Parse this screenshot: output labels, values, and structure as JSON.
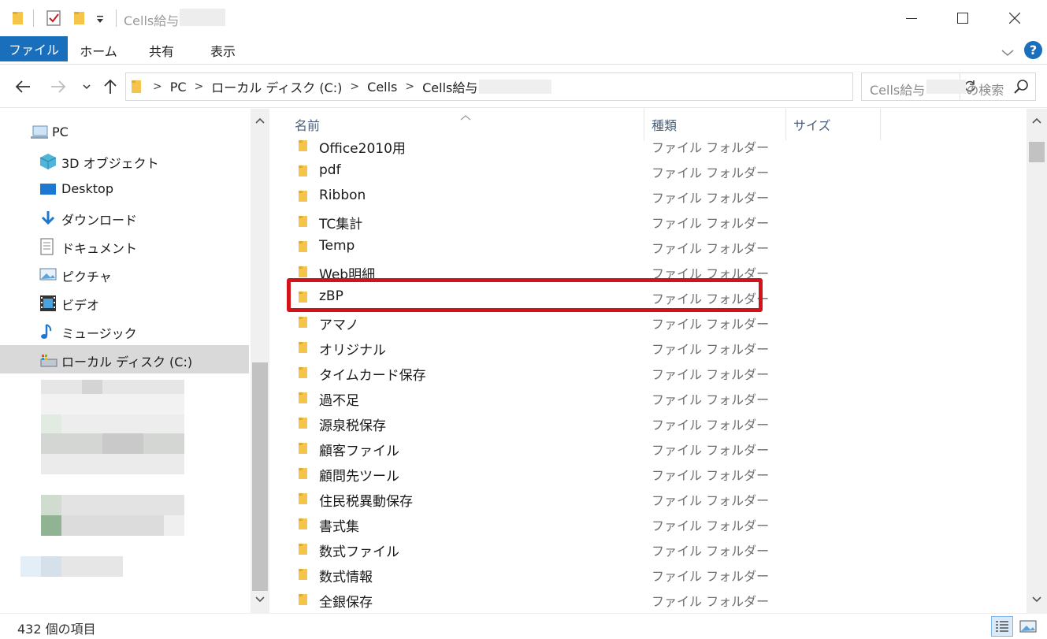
{
  "window": {
    "title": "Cells給与",
    "controls": {
      "minimize": "─",
      "maximize": "☐",
      "close": "✕"
    }
  },
  "ribbon": {
    "tabs": [
      {
        "label": "ファイル",
        "active": true
      },
      {
        "label": "ホーム"
      },
      {
        "label": "共有"
      },
      {
        "label": "表示"
      }
    ],
    "help_label": "?"
  },
  "address": {
    "crumbs": [
      "PC",
      "ローカル ディスク (C:)",
      "Cells",
      "Cells給与"
    ],
    "search_placeholder_prefix": "Cells給与",
    "search_placeholder_suffix": "の検索"
  },
  "nav": {
    "items": [
      {
        "label": "PC",
        "icon": "pc-icon"
      },
      {
        "label": "3D オブジェクト",
        "icon": "3d-objects-icon"
      },
      {
        "label": "Desktop",
        "icon": "desktop-icon"
      },
      {
        "label": "ダウンロード",
        "icon": "download-icon"
      },
      {
        "label": "ドキュメント",
        "icon": "document-icon"
      },
      {
        "label": "ピクチャ",
        "icon": "pictures-icon"
      },
      {
        "label": "ビデオ",
        "icon": "video-icon"
      },
      {
        "label": "ミュージック",
        "icon": "music-icon"
      },
      {
        "label": "ローカル ディスク (C:)",
        "icon": "local-disk-icon",
        "selected": true
      }
    ]
  },
  "columns": {
    "name": "名前",
    "type": "種類",
    "size": "サイズ"
  },
  "files": [
    {
      "name": "Office2010用",
      "type": "ファイル フォルダー"
    },
    {
      "name": "pdf",
      "type": "ファイル フォルダー"
    },
    {
      "name": "Ribbon",
      "type": "ファイル フォルダー"
    },
    {
      "name": "TC集計",
      "type": "ファイル フォルダー"
    },
    {
      "name": "Temp",
      "type": "ファイル フォルダー"
    },
    {
      "name": "Web明細",
      "type": "ファイル フォルダー"
    },
    {
      "name": "zBP",
      "type": "ファイル フォルダー",
      "highlighted": true
    },
    {
      "name": "アマノ",
      "type": "ファイル フォルダー"
    },
    {
      "name": "オリジナル",
      "type": "ファイル フォルダー"
    },
    {
      "name": "タイムカード保存",
      "type": "ファイル フォルダー"
    },
    {
      "name": "過不足",
      "type": "ファイル フォルダー"
    },
    {
      "name": "源泉税保存",
      "type": "ファイル フォルダー"
    },
    {
      "name": "顧客ファイル",
      "type": "ファイル フォルダー"
    },
    {
      "name": "顧問先ツール",
      "type": "ファイル フォルダー"
    },
    {
      "name": "住民税異動保存",
      "type": "ファイル フォルダー"
    },
    {
      "name": "書式集",
      "type": "ファイル フォルダー"
    },
    {
      "name": "数式ファイル",
      "type": "ファイル フォルダー"
    },
    {
      "name": "数式情報",
      "type": "ファイル フォルダー"
    },
    {
      "name": "全銀保存",
      "type": "ファイル フォルダー"
    }
  ],
  "status": {
    "item_count": "432 個の項目"
  },
  "colors": {
    "accent": "#1a6fbd",
    "highlight": "#d2141a",
    "folder": "#f4c54a"
  }
}
